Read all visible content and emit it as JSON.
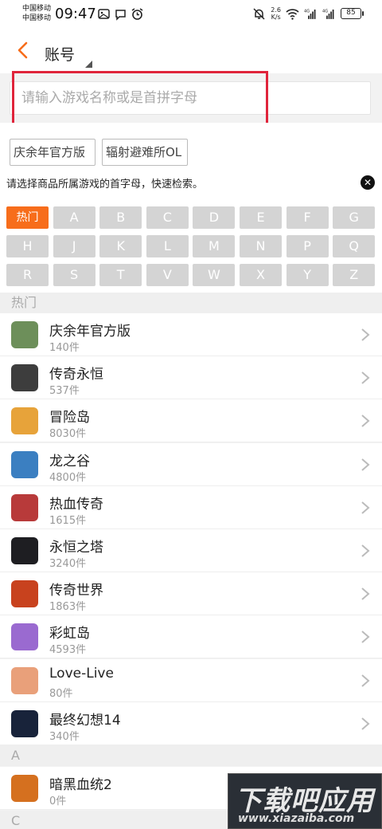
{
  "status_bar": {
    "carrier_1": "中国移动",
    "carrier_2": "中国移动",
    "time": "09:47",
    "net_speed_value": "2.6",
    "net_speed_unit": "K/s",
    "signal_1_label": "4G",
    "signal_2_label": "4G",
    "battery": "85"
  },
  "header": {
    "title": "账号"
  },
  "search": {
    "placeholder": "请输入游戏名称或是首拼字母"
  },
  "recent": {
    "chips": [
      "庆余年官方版",
      "辐射避难所OL"
    ],
    "hint": "请选择商品所属游戏的首字母，快速检索。"
  },
  "letters": [
    "热门",
    "A",
    "B",
    "C",
    "D",
    "E",
    "F",
    "G",
    "H",
    "J",
    "K",
    "L",
    "M",
    "N",
    "P",
    "Q",
    "R",
    "S",
    "T",
    "V",
    "W",
    "X",
    "Y",
    "Z"
  ],
  "sections": {
    "hot": "热门",
    "a": "A",
    "c": "C"
  },
  "games": [
    {
      "name": "庆余年官方版",
      "count": "140件",
      "color": "#6d8f5a"
    },
    {
      "name": "传奇永恒",
      "count": "537件",
      "color": "#3d3d3d"
    },
    {
      "name": "冒险岛",
      "count": "8030件",
      "color": "#e7a33a"
    },
    {
      "name": "龙之谷",
      "count": "4800件",
      "color": "#3b7fc1"
    },
    {
      "name": "热血传奇",
      "count": "1615件",
      "color": "#b83a3a"
    },
    {
      "name": "永恒之塔",
      "count": "3240件",
      "color": "#1e1e22"
    },
    {
      "name": "传奇世界",
      "count": "1863件",
      "color": "#c8421e"
    },
    {
      "name": "彩虹岛",
      "count": "4593件",
      "color": "#9a6ad0"
    },
    {
      "name": "Love-Live",
      "count": "80件",
      "color": "#e9a07a"
    },
    {
      "name": "最终幻想14",
      "count": "340件",
      "color": "#18233a"
    },
    {
      "name": "暗黑血统2",
      "count": "0件",
      "color": "#d5701f"
    }
  ],
  "watermark": {
    "title": "下载吧应用",
    "url": "www.xiazaiba.com"
  }
}
